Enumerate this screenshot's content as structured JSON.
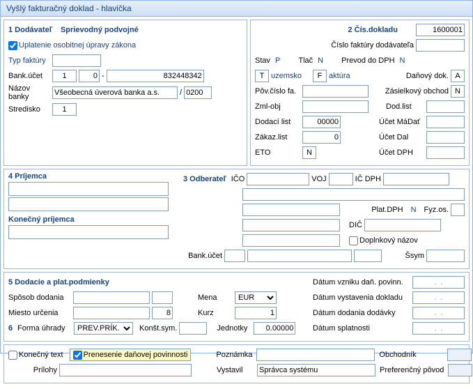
{
  "title": "Vyšlý fakturačný doklad - hlavička",
  "s1": {
    "heading": "1 Dodávateľ",
    "sprievodny": "Sprievodný podvojné",
    "uplatenie": "Uplatenie osobitnej úpravy zákona",
    "typ_faktury_lbl": "Typ faktúry",
    "bank_ucet_lbl": "Bank.účet",
    "bank_ucet_a": "1",
    "bank_ucet_b": "0",
    "bank_ucet_c": "832448342",
    "nazov_banky_lbl": "Názov banky",
    "nazov_banky": "Všeobecná úverová banka a.s.",
    "kod_banky": "0200",
    "stredisko_lbl": "Stredisko",
    "stredisko": "1"
  },
  "s2": {
    "heading": "2 Čís.dokladu",
    "cislo_dokladu": "1600001",
    "cislo_faktury_lbl": "Číslo faktúry dodávateľa",
    "stav_lbl": "Stav",
    "stav_val": "P",
    "tlac_lbl": "Tlač",
    "tlac_val": "N",
    "prevod_lbl": "Prevod do DPH",
    "prevod_val": "N",
    "t_code": "T",
    "t_text": "uzemsko",
    "f_code": "F",
    "f_text": "aktúra",
    "danovy_dok_lbl": "Daňový dok.",
    "danovy_dok": "A",
    "pov_cislo_lbl": "Pôv.číslo fa.",
    "zasielkovy_lbl": "Zásielkový obchod",
    "zasielkovy": "N",
    "zmlobj_lbl": "Zml-obj",
    "dodlist_lbl": "Dod.list",
    "dodaci_list_lbl": "Dodací list",
    "dodaci_list": "00000",
    "ucet_madat_lbl": "Účet MáDať",
    "zakaz_list_lbl": "Zákaz.list",
    "zakaz_list": "0",
    "ucet_dal_lbl": "Účet Dal",
    "eto_lbl": "ETO",
    "eto": "N",
    "ucet_dph_lbl": "Účet DPH"
  },
  "s3": {
    "heading": "3 Odberateľ",
    "ico_lbl": "IČO",
    "voj_lbl": "VOJ",
    "icdph_lbl": "IČ DPH",
    "platdph_lbl": "Plat.DPH",
    "platdph": "N",
    "fyzos_lbl": "Fyz.os.",
    "dic_lbl": "DIČ",
    "doplnkovy_lbl": "Doplnkový názov",
    "bank_ucet_lbl": "Bank.účet",
    "ssym_lbl": "Šsym"
  },
  "s4": {
    "heading": "4 Príjemca",
    "konecny_lbl": "Konečný príjemca"
  },
  "s5": {
    "heading": "5 Dodacie a plat.podmienky",
    "sposob_lbl": "Spôsob dodania",
    "miesto_lbl": "Miesto určenia",
    "miesto_val": "8",
    "forma_lbl": "Forma úhrady",
    "forma_val": "PREV.PRÍK.",
    "konst_lbl": "Konšt.sym.",
    "mena_lbl": "Mena",
    "mena": "EUR",
    "kurz_lbl": "Kurz",
    "kurz": "1",
    "jednotky_lbl": "Jednotky",
    "jednotky": "0.00000",
    "dat_vznik_lbl": "Dátum vzniku daň. povinn.",
    "dat_vyst_lbl": "Dátum vystavenia dokladu",
    "dat_dod_lbl": "Dátum dodania dodávky",
    "dat_splat_lbl": "Dátum splatnosti",
    "date_ph": " .  . ",
    "six": "6"
  },
  "footer": {
    "konecny_text_lbl": "Konečný text",
    "prenesenie_lbl": "Prenesenie daňovej povinnosti",
    "prilohy_lbl": "Prílohy",
    "poznamka_lbl": "Poznámka",
    "vystavil_lbl": "Vystavil",
    "vystavil": "Správca systému",
    "obchodnik_lbl": "Obchodník",
    "preferencny_lbl": "Preferenčný pôvod"
  }
}
